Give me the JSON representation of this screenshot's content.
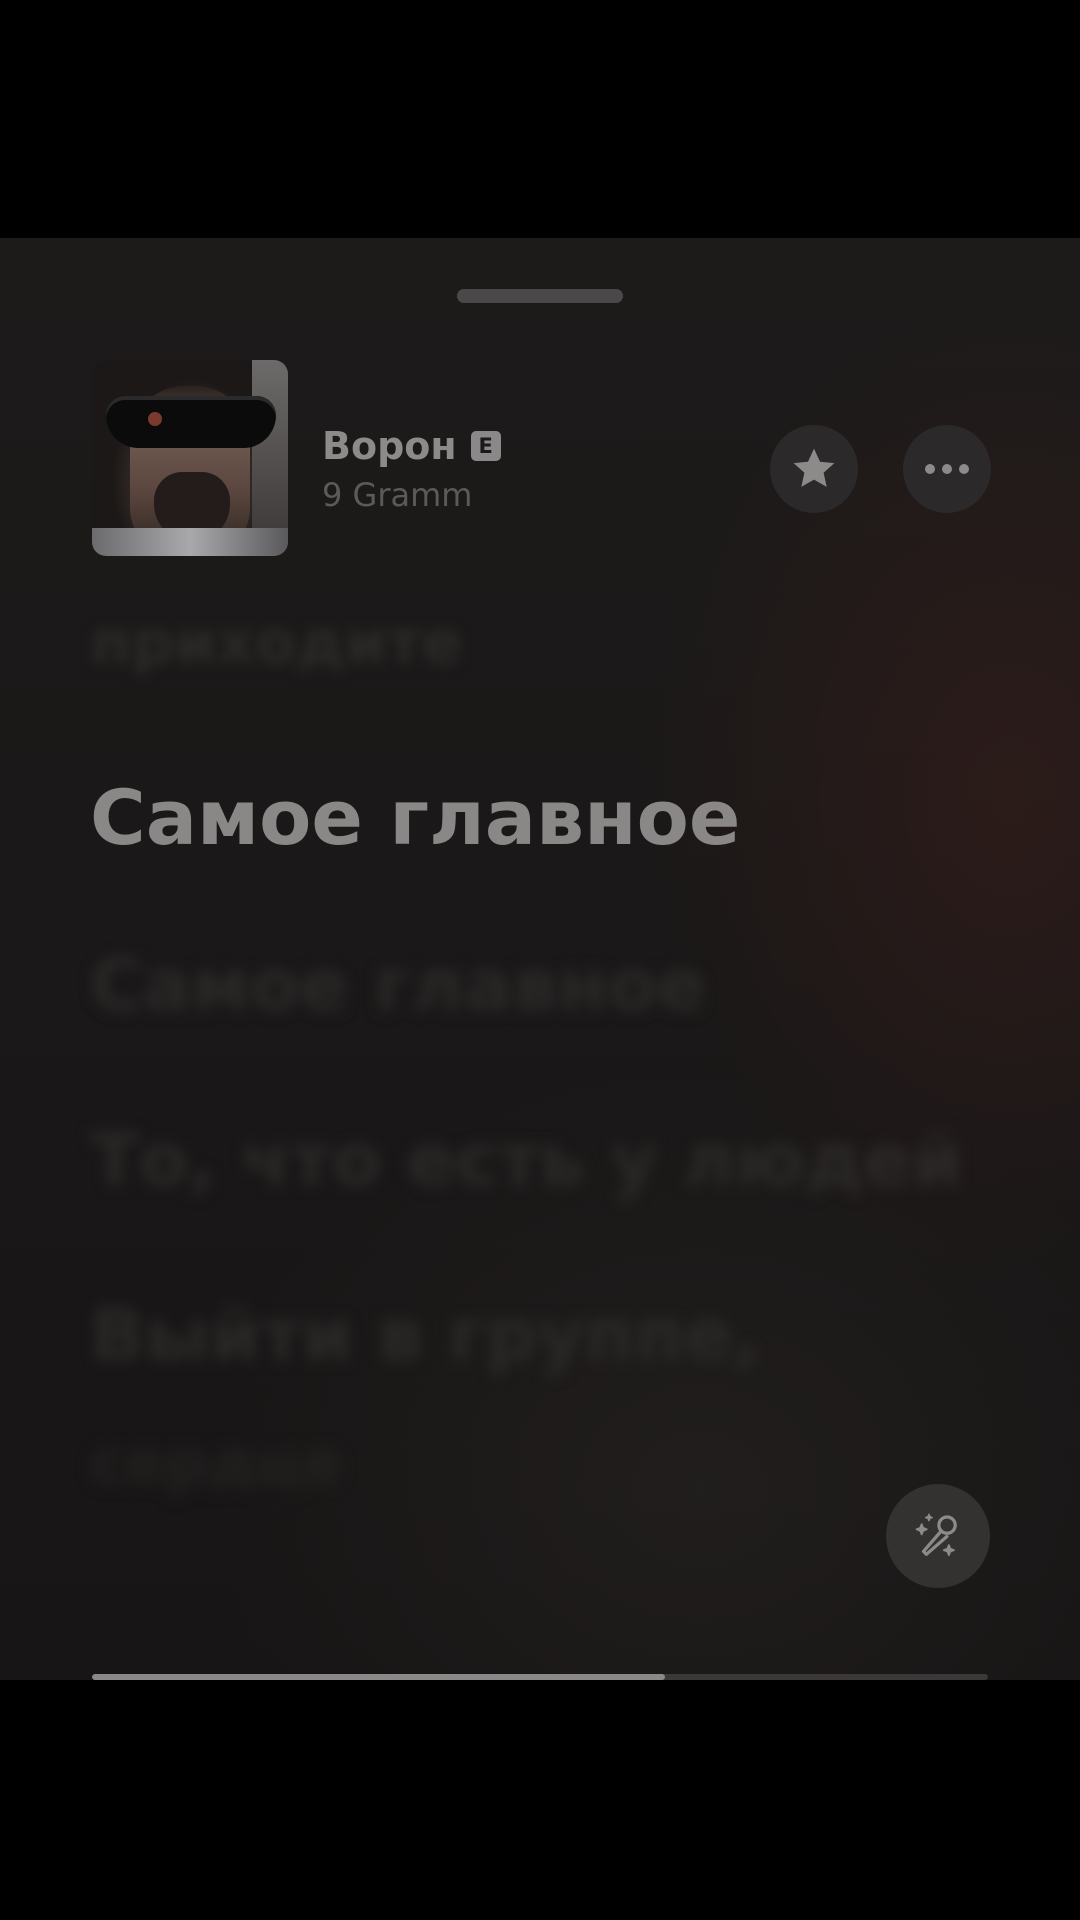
{
  "track": {
    "title": "Ворон",
    "explicit_badge": "E",
    "artist": "9 Gramm"
  },
  "lyrics": {
    "previous_line": "приходите",
    "current_line": "Самое главное",
    "upcoming_lines": [
      "Самое главное",
      "То, что есть у людей",
      "Выйти в группе,",
      "сердце"
    ]
  },
  "playback": {
    "progress_fraction": 0.64
  },
  "icons": {
    "favorite": "star-icon",
    "more": "ellipsis-icon",
    "sing": "microphone-sparkles-icon"
  },
  "colors": {
    "sheet_background": "#1c1a1a",
    "active_lyric": "#8a8887",
    "dimmed_lyric": "#2b2928"
  }
}
